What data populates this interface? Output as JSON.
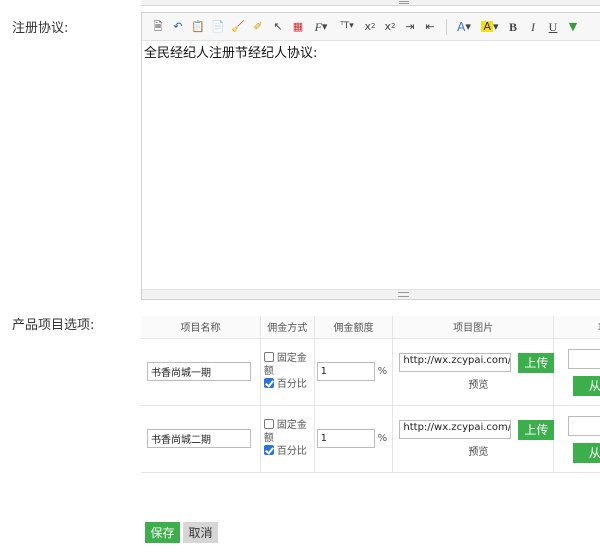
{
  "form": {
    "agreement_label": "注册协议:",
    "products_label": "产品项目选项:",
    "save_label": "保存",
    "cancel_label": "取消"
  },
  "editor": {
    "content": "全民经纪人注册节经纪人协议:",
    "toolbar": [
      "source-icon",
      "undo-icon",
      "paste-icon",
      "paste-text-icon",
      "cleanup-icon",
      "spellcheck-icon",
      "select-icon",
      "pagebreak-icon",
      "font-family-icon",
      "font-size-icon",
      "subscript-icon",
      "superscript-icon",
      "indent-icon",
      "outdent-icon",
      "font-color-icon",
      "highlight-icon",
      "bold-icon",
      "italic-icon",
      "underline-icon",
      "insert-icon"
    ]
  },
  "products": {
    "columns": [
      "项目名称",
      "佣金方式",
      "佣金额度",
      "项目图片",
      "项"
    ],
    "mode_fixed": "固定金额",
    "mode_percent": "百分比",
    "percent_sign": "%",
    "upload_label": "上传",
    "preview_label": "预览",
    "ext_button_label": "从",
    "rows": [
      {
        "name": "书香尚城一期",
        "fixed_checked": false,
        "percent_checked": true,
        "rate": "1",
        "image_url": "http://wx.zcypai.com/tj"
      },
      {
        "name": "书香尚城二期",
        "fixed_checked": false,
        "percent_checked": true,
        "rate": "1",
        "image_url": "http://wx.zcypai.com/tj"
      }
    ]
  },
  "colors": {
    "accent_green": "#3cae4c",
    "checkbox_blue": "#2a74d9"
  }
}
